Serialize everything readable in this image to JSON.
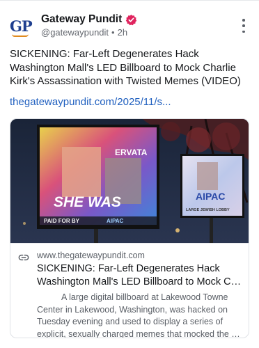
{
  "author": {
    "name": "Gateway Pundit",
    "handle": "@gatewaypundit",
    "separator": "•",
    "time": "2h",
    "avatar_text": "GP"
  },
  "post": {
    "text": "SICKENING: Far-Left Degenerates Hack Washington Mall's LED Billboard to Mock Charlie Kirk's Assassination with Twisted Memes (VIDEO)",
    "link_text": "thegatewaypundit.com/2025/11/s..."
  },
  "card": {
    "domain": "www.thegatewaypundit.com",
    "title_line1": "SICKENING: Far-Left Degenerates Hack",
    "title_line2": "Washington Mall's LED Billboard to Mock Charli...",
    "desc_lines": [
      "A large digital billboard at Lakewood Towne",
      "Center in Lakewood, Washington, was hacked on",
      "Tuesday evening and used to display a series of",
      "explicit, sexually charged memes that mocked the ass..."
    ],
    "image_text": {
      "billboard_top": "ERVATA",
      "billboard_main": "SHE WAS",
      "billboard_bottom": "PAID FOR BY",
      "billboard_bottom2": "AIPAC",
      "right_main": "AIPAC",
      "right_sub": "LARGE JEWISH LOBBY"
    }
  },
  "icons": {
    "verified": "verified-badge-icon",
    "more": "more-vertical-icon",
    "link": "link-icon"
  },
  "colors": {
    "verified": "#e0245e",
    "link": "#1f5fbf",
    "brand": "#1f3f8f",
    "brand_accent": "#e08a1e"
  }
}
